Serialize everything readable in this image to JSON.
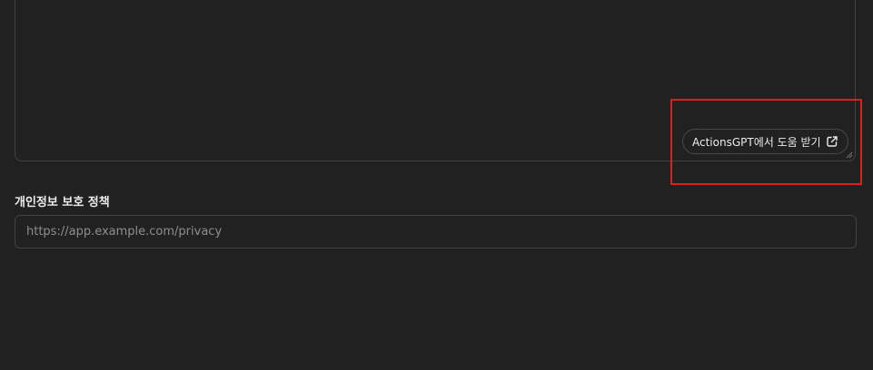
{
  "schema_editor": {
    "help_button_label": "ActionsGPT에서 도움 받기",
    "help_button_icon": "external-link-icon"
  },
  "privacy_policy": {
    "label": "개인정보 보호 정책",
    "placeholder": "https://app.example.com/privacy",
    "value": ""
  },
  "colors": {
    "background": "#212121",
    "border": "#424242",
    "highlight": "#d9201f",
    "text": "#ececec",
    "placeholder": "#8e8e8e"
  }
}
